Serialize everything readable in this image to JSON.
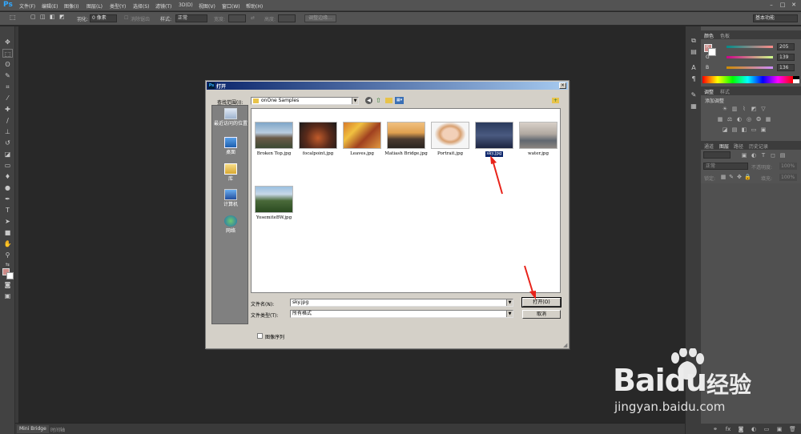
{
  "app": {
    "logo": "Ps"
  },
  "menu": [
    "文件(F)",
    "编辑(E)",
    "图像(I)",
    "图层(L)",
    "类型(Y)",
    "选择(S)",
    "滤镜(T)",
    "3D(D)",
    "视图(V)",
    "窗口(W)",
    "帮助(H)"
  ],
  "window_buttons": [
    "–",
    "□",
    "✕"
  ],
  "options": {
    "feather_label": "羽化:",
    "feather_value": "0 像素",
    "antialias_label": "消除锯齿",
    "style_label": "样式:",
    "style_value": "正常",
    "width_label": "宽度:",
    "height_label": "高度:",
    "refine_button": "调整边缘...",
    "workspace": "基本功能"
  },
  "panels": {
    "color_tabs": [
      "颜色",
      "色板"
    ],
    "rgb": [
      {
        "label": "R",
        "value": "205"
      },
      {
        "label": "G",
        "value": "139"
      },
      {
        "label": "B",
        "value": "136"
      }
    ],
    "foreground_color": "#cd8b88",
    "adjust_tabs": [
      "调整",
      "样式"
    ],
    "adjust_title": "添加调整",
    "layer_tabs": [
      "通道",
      "图层",
      "路径",
      "历史记录"
    ],
    "blend_mode": "正常",
    "opacity_label": "不透明度:",
    "opacity_value": "100%",
    "lock_label": "锁定:",
    "fill_label": "填充:",
    "fill_value": "100%"
  },
  "bottom_tabs": [
    "Mini Bridge",
    "时间轴"
  ],
  "dialog": {
    "title": "打开",
    "lookin_label": "查找范围(I):",
    "lookin_value": "onOne Samples",
    "places": [
      {
        "label": "最近访问的位置",
        "icon": "recent-places-icon"
      },
      {
        "label": "桌面",
        "icon": "desktop-icon"
      },
      {
        "label": "库",
        "icon": "libraries-icon"
      },
      {
        "label": "计算机",
        "icon": "computer-icon"
      },
      {
        "label": "网络",
        "icon": "network-icon"
      }
    ],
    "files": [
      {
        "name": "Broken Top.jpg",
        "selected": false
      },
      {
        "name": "focalpoint.jpg",
        "selected": false
      },
      {
        "name": "Leaves.jpg",
        "selected": false
      },
      {
        "name": "Matiash Bridge.jpg",
        "selected": false
      },
      {
        "name": "Portrait.jpg",
        "selected": false
      },
      {
        "name": "sky.jpg",
        "selected": true
      },
      {
        "name": "water.jpg",
        "selected": false
      },
      {
        "name": "YosemiteBW.jpg",
        "selected": false
      }
    ],
    "filename_label": "文件名(N):",
    "filename_value": "sky.jpg",
    "filetype_label": "文件类型(T):",
    "filetype_value": "所有格式",
    "open_button": "打开(O)",
    "cancel_button": "取消",
    "image_sequence_label": "图像序列"
  },
  "watermark": {
    "brand": "Baidu",
    "cn": "经验",
    "url": "jingyan.baidu.com"
  }
}
